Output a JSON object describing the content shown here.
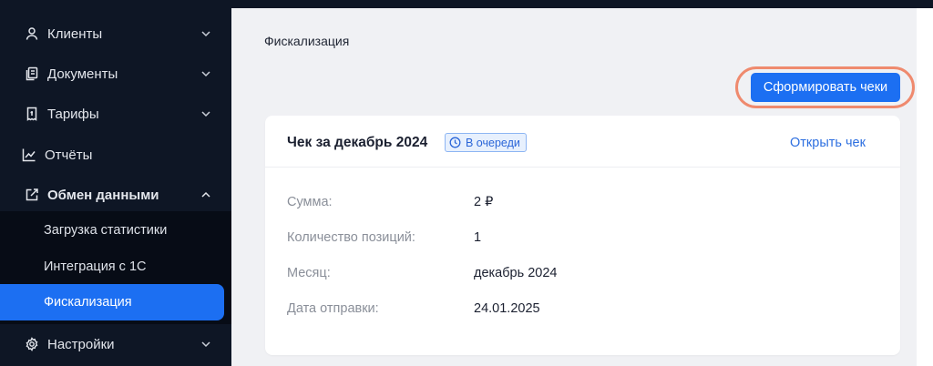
{
  "sidebar": {
    "items": [
      {
        "label": "Клиенты",
        "icon": "user-icon"
      },
      {
        "label": "Документы",
        "icon": "documents-icon"
      },
      {
        "label": "Тарифы",
        "icon": "tariff-icon"
      },
      {
        "label": "Отчёты",
        "icon": "chart-icon"
      },
      {
        "label": "Обмен данными",
        "icon": "exchange-icon"
      },
      {
        "label": "Настройки",
        "icon": "gear-icon"
      }
    ],
    "submenu": [
      {
        "label": "Загрузка статистики"
      },
      {
        "label": "Интеграция с 1С"
      },
      {
        "label": "Фискализация",
        "active": true
      }
    ]
  },
  "main": {
    "title": "Фискализация",
    "primary_button": "Сформировать чеки"
  },
  "card": {
    "title": "Чек за декабрь 2024",
    "badge": "В очереди",
    "open_link": "Открыть чек",
    "rows": [
      {
        "label": "Сумма:",
        "value": "2 ₽"
      },
      {
        "label": "Количество позиций:",
        "value": "1"
      },
      {
        "label": "Месяц:",
        "value": "декабрь 2024"
      },
      {
        "label": "Дата отправки:",
        "value": "24.01.2025"
      }
    ]
  },
  "colors": {
    "sidebar_bg": "#0e1625",
    "submenu_bg": "#070c16",
    "accent": "#1c6ff2",
    "highlight_ring": "#ef8a6e",
    "page_bg": "#f0f1f4"
  }
}
